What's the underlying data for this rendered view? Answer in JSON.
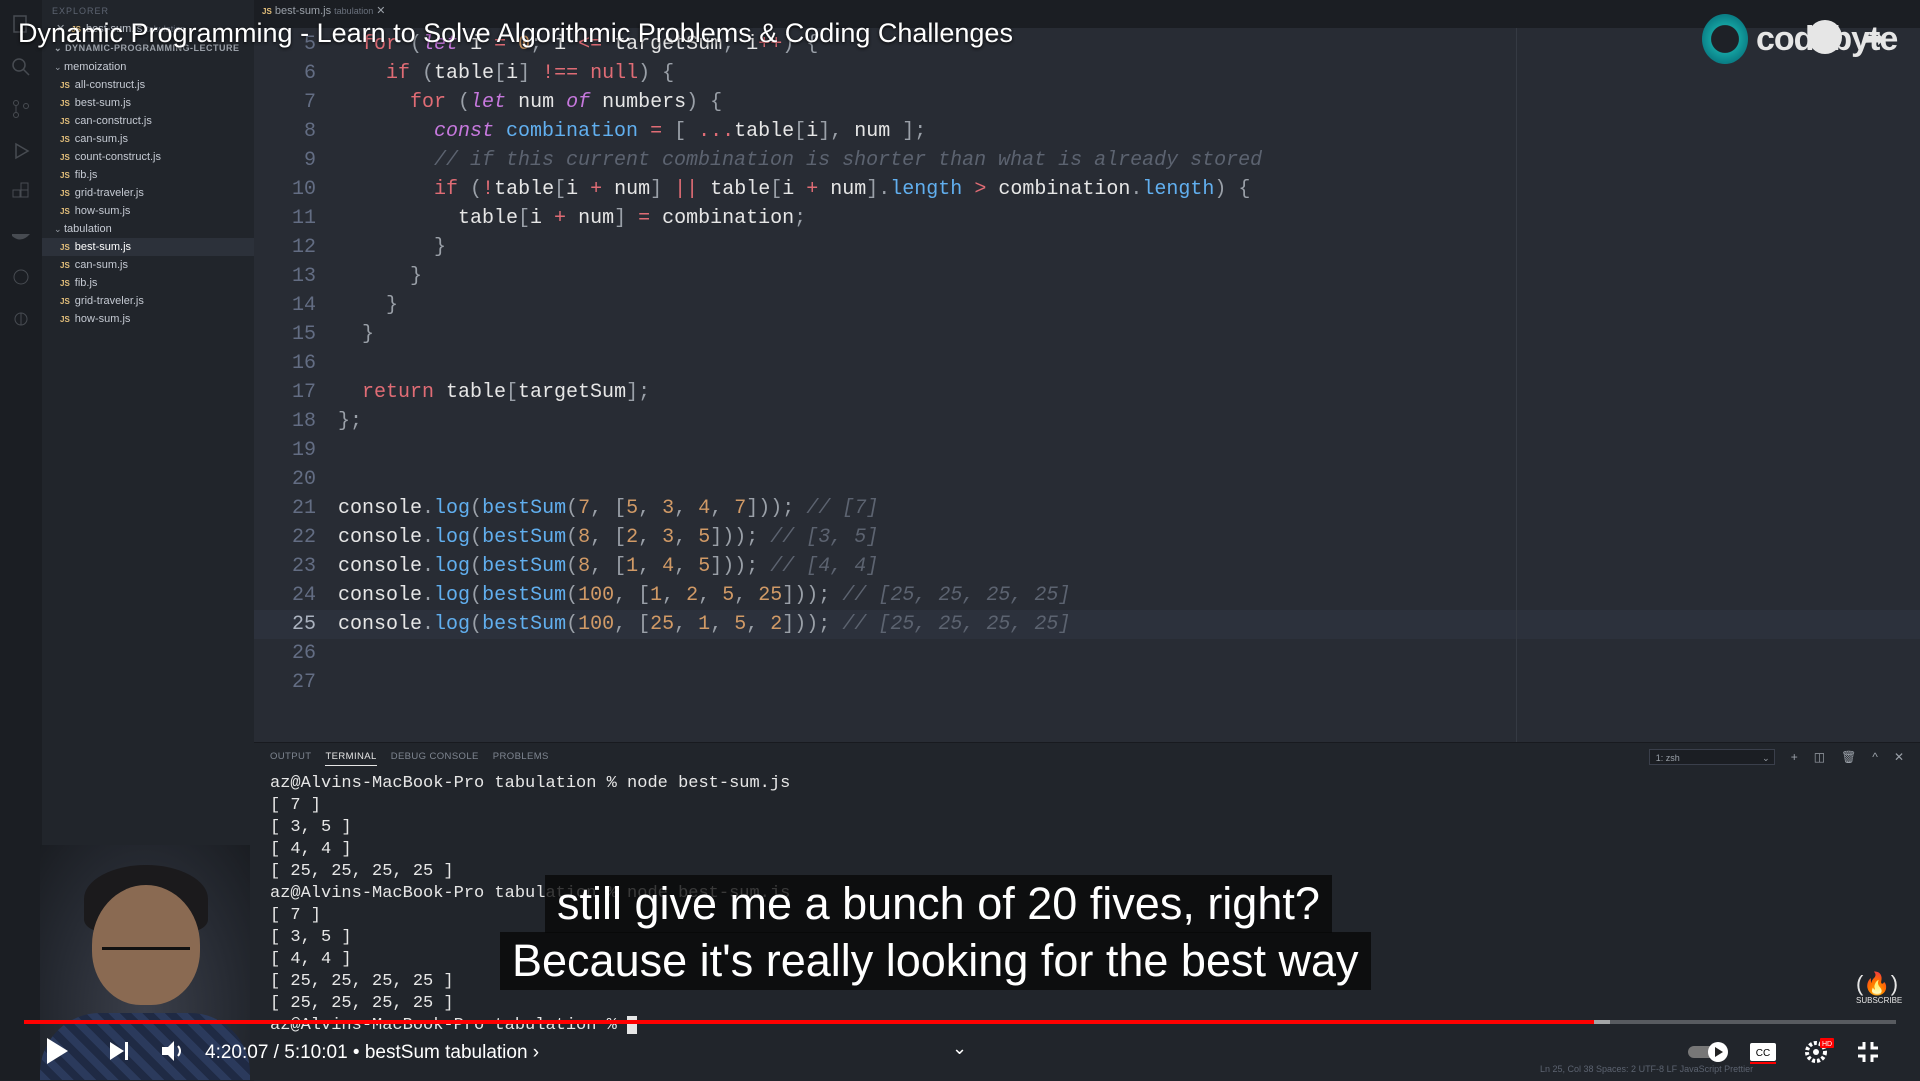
{
  "video": {
    "title": "Dynamic Programming - Learn to Solve Algorithmic Problems & Coding Challenges",
    "channel_logo_text": "codebyte",
    "time_current": "4:20:07",
    "time_sep": " / ",
    "time_total": "5:10:01",
    "chapter": " • bestSum tabulation ›",
    "progress_fraction": 0.8386,
    "buffer_fraction": 0.8472,
    "subscribe_label": "SUBSCRIBE",
    "hd_badge": "HD"
  },
  "captions": [
    "still give me a bunch of 20 fives, right?",
    "Because it's really looking for the best way"
  ],
  "sidebar": {
    "header": "EXPLORER",
    "open_editor": {
      "name": "best-sum.js",
      "tag": "tabulation"
    },
    "project": "DYNAMIC-PROGRAMMING-LECTURE",
    "folders": [
      {
        "name": "memoization",
        "files": [
          "all-construct.js",
          "best-sum.js",
          "can-construct.js",
          "can-sum.js",
          "count-construct.js",
          "fib.js",
          "grid-traveler.js",
          "how-sum.js"
        ]
      },
      {
        "name": "tabulation",
        "files": [
          "best-sum.js",
          "can-sum.js",
          "fib.js",
          "grid-traveler.js",
          "how-sum.js"
        ]
      }
    ]
  },
  "tab": {
    "name": "best-sum.js",
    "tag": "tabulation"
  },
  "editor": {
    "line_numbers": [
      "5",
      "6",
      "7",
      "8",
      "9",
      "10",
      "11",
      "12",
      "13",
      "14",
      "15",
      "16",
      "17",
      "18",
      "19",
      "20",
      "21",
      "22",
      "23",
      "24",
      "25",
      "26",
      "27"
    ],
    "current_line_index": 20
  },
  "panel": {
    "tabs": [
      "OUTPUT",
      "TERMINAL",
      "DEBUG CONSOLE",
      "PROBLEMS"
    ],
    "active_tab": "TERMINAL",
    "shell": "1: zsh",
    "terminal_lines": [
      "az@Alvins-MacBook-Pro tabulation % node best-sum.js",
      "[ 7 ]",
      "[ 3, 5 ]",
      "[ 4, 4 ]",
      "[ 25, 25, 25, 25 ]",
      "az@Alvins-MacBook-Pro tabulation % node best-sum.js",
      "[ 7 ]",
      "[ 3, 5 ]",
      "[ 4, 4 ]",
      "[ 25, 25, 25, 25 ]",
      "[ 25, 25, 25, 25 ]",
      "az@Alvins-MacBook-Pro tabulation % "
    ]
  },
  "statusbar": "Ln 25, Col 38   Spaces: 2   UTF-8   LF   JavaScript   Prettier",
  "colors": {
    "accent_red": "#ff0000",
    "editor_bg": "#282c34",
    "keyword": "#e06c75"
  }
}
